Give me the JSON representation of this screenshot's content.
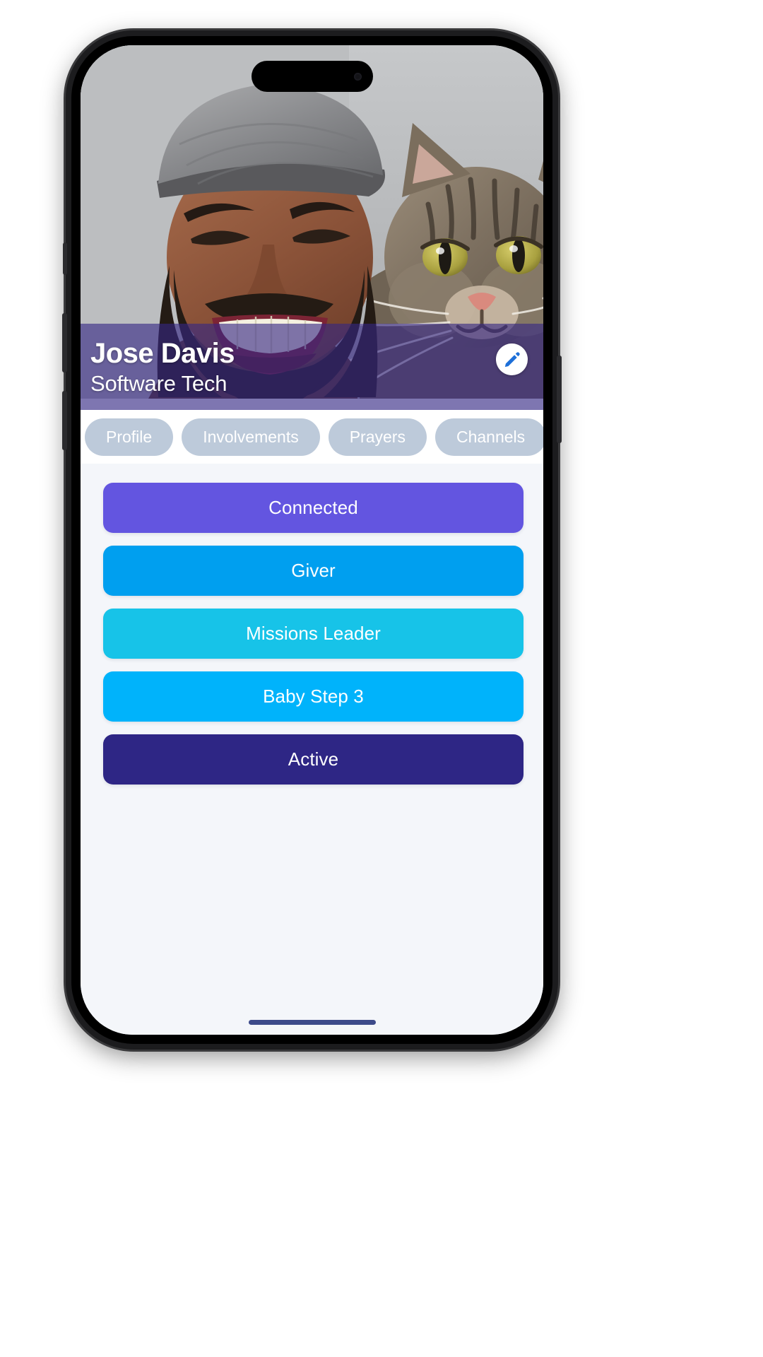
{
  "app": {
    "background_color": "#ffffff",
    "screen_background": "#f4f6fa"
  },
  "profile": {
    "name": "Jose Davis",
    "role": "Software Tech",
    "band_color": "#362685",
    "edit_button_label": "Edit profile",
    "edit_icon": "pencil-icon",
    "edit_icon_color": "#1d6fd8"
  },
  "tabs": {
    "items": [
      {
        "label": "Profile",
        "selected": false
      },
      {
        "label": "Involvements",
        "selected": false
      },
      {
        "label": "Prayers",
        "selected": false
      },
      {
        "label": "Channels",
        "selected": false
      }
    ],
    "pill_color": "#bdcada",
    "text_color": "#ffffff"
  },
  "badges": {
    "items": [
      {
        "label": "Connected",
        "color": "#6355e0"
      },
      {
        "label": "Giver",
        "color": "#009fef"
      },
      {
        "label": "Missions Leader",
        "color": "#17c3e8"
      },
      {
        "label": "Baby Step 3",
        "color": "#00b3fb"
      },
      {
        "label": "Active",
        "color": "#2e2685"
      }
    ]
  },
  "device": {
    "home_indicator_color": "#3d4a8a",
    "frame_color": "#1c1c1e"
  }
}
